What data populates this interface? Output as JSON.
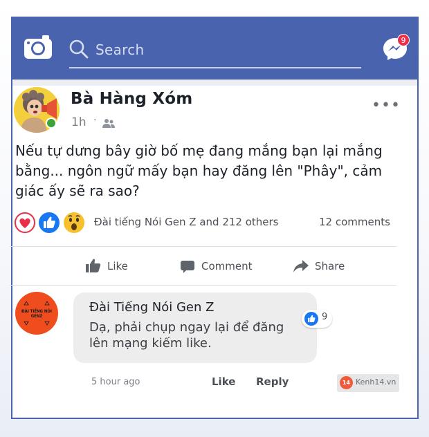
{
  "header": {
    "search_placeholder": "Search",
    "messenger_badge": "9"
  },
  "post": {
    "author": "Bà Hàng Xóm",
    "time": "1h",
    "separator": "·",
    "text": "Nếu tự dưng bây giờ bố mẹ đang mắng bạn lại mắng bằng... ngôn ngữ mấy bạn hay đăng lên \"Phây\", cảm giác ấy sẽ ra sao?",
    "reactions_text": "Đài tiếng Nói Gen Z and 212 others",
    "comments_count": "12 comments",
    "more": "•••"
  },
  "actions": {
    "like": "Like",
    "comment": "Comment",
    "share": "Share"
  },
  "comment": {
    "author": "Đài Tiếng Nói Gen Z",
    "avatar_text": "ĐÀI TIẾNG NÓI GENZ",
    "text": "Dạ, phải chụp ngay lại để đăng lên mạng kiếm like.",
    "reaction_count": "9",
    "time": "5 hour ago",
    "like": "Like",
    "reply": "Reply"
  },
  "watermark": {
    "logo": "14",
    "text": "Kenh14.vn"
  },
  "colors": {
    "brand_blue": "#4a63ae",
    "like_blue": "#1877f2",
    "heart_red": "#e8304a"
  }
}
